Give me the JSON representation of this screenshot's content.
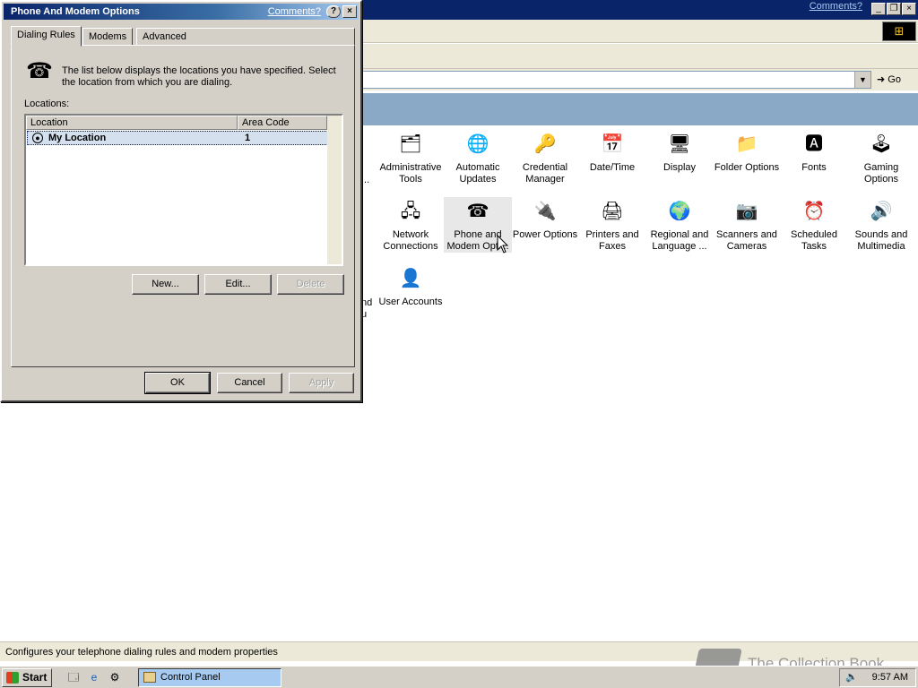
{
  "background_window": {
    "comments_link": "Comments?",
    "go_label": "Go",
    "status_text": "Configures your telephone dialing rules and modem properties",
    "icons": [
      {
        "label": "Administrative Tools",
        "icon": "admin-tools-icon",
        "glyph": "🗂"
      },
      {
        "label": "Automatic Updates",
        "icon": "globe-update-icon",
        "glyph": "🌐"
      },
      {
        "label": "Credential Manager",
        "icon": "keys-icon",
        "glyph": "🔑"
      },
      {
        "label": "Date/Time",
        "icon": "calendar-clock-icon",
        "glyph": "📅"
      },
      {
        "label": "Display",
        "icon": "monitor-icon",
        "glyph": "🖥"
      },
      {
        "label": "Folder Options",
        "icon": "folder-options-icon",
        "glyph": "📁"
      },
      {
        "label": "Fonts",
        "icon": "fonts-folder-icon",
        "glyph": "🅰"
      },
      {
        "label": "Gaming Options",
        "icon": "joystick-icon",
        "glyph": "🕹"
      },
      {
        "label": "Network Connections",
        "icon": "network-icon",
        "glyph": "🖧"
      },
      {
        "label": "Phone and Modem Opti...",
        "icon": "phone-icon",
        "glyph": "☎"
      },
      {
        "label": "Power Options",
        "icon": "power-icon",
        "glyph": "🔌"
      },
      {
        "label": "Printers and Faxes",
        "icon": "printer-icon",
        "glyph": "🖨"
      },
      {
        "label": "Regional and Language ...",
        "icon": "globe-icon",
        "glyph": "🌍"
      },
      {
        "label": "Scanners and Cameras",
        "icon": "camera-icon",
        "glyph": "📷"
      },
      {
        "label": "Scheduled Tasks",
        "icon": "scheduled-tasks-icon",
        "glyph": "⏰"
      },
      {
        "label": "Sounds and Multimedia",
        "icon": "speaker-icon",
        "glyph": "🔊"
      },
      {
        "label": "User Accounts",
        "icon": "user-icon",
        "glyph": "👤"
      }
    ],
    "partial_labels": [
      "...",
      "nd",
      "u"
    ]
  },
  "dialog": {
    "title": "Phone And Modem Options",
    "comments_link": "Comments?",
    "help_btn": "?",
    "close_btn": "×",
    "tabs": [
      "Dialing Rules",
      "Modems",
      "Advanced"
    ],
    "description": "The list below displays the locations you have specified. Select the location from which you are dialing.",
    "locations_label": "Locations:",
    "columns": [
      "Location",
      "Area Code"
    ],
    "rows": [
      {
        "location": "My Location",
        "area_code": "1"
      }
    ],
    "buttons": {
      "new": "New...",
      "edit": "Edit...",
      "delete": "Delete",
      "ok": "OK",
      "cancel": "Cancel",
      "apply": "Apply"
    }
  },
  "taskbar": {
    "start": "Start",
    "task": "Control Panel",
    "clock": "9:57 AM"
  },
  "watermark": "The Collection Book"
}
